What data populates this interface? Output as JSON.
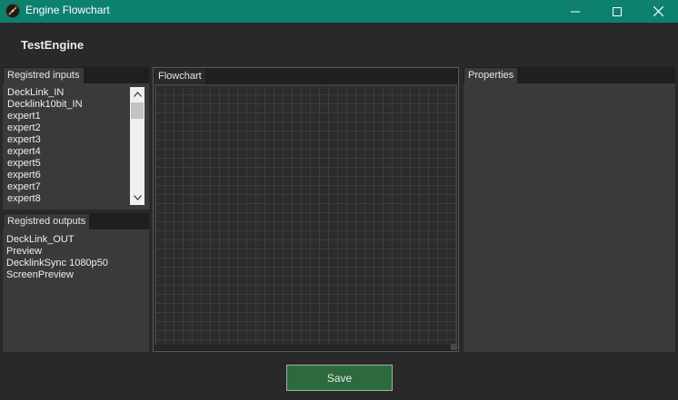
{
  "window": {
    "title": "Engine Flowchart",
    "icons": {
      "app": "compass-icon",
      "minimize": "minimize-icon",
      "maximize": "maximize-icon",
      "close": "close-icon"
    }
  },
  "engine": {
    "name": "TestEngine"
  },
  "inputs": {
    "header": "Registred inputs",
    "items": [
      "DeckLink_IN",
      "Decklink10bit_IN",
      "expert1",
      "expert2",
      "expert3",
      "expert4",
      "expert5",
      "expert6",
      "expert7",
      "expert8"
    ]
  },
  "outputs": {
    "header": "Registred outputs",
    "items": [
      "DeckLink_OUT",
      "Preview",
      "DecklinkSync 1080p50",
      "ScreenPreview"
    ]
  },
  "flowchart": {
    "header": "Flowchart"
  },
  "properties": {
    "header": "Properties"
  },
  "actions": {
    "save_label": "Save"
  },
  "colors": {
    "titlebar": "#0e806e",
    "save_button": "#2c6a3e",
    "background": "#292929",
    "panel": "#3a3a3a"
  }
}
